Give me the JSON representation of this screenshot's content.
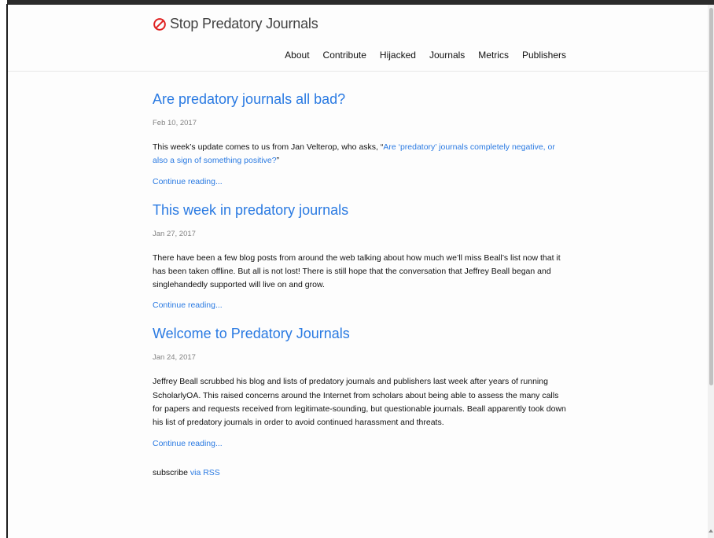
{
  "site": {
    "title": "Stop Predatory Journals"
  },
  "nav": {
    "items": [
      "About",
      "Contribute",
      "Hijacked",
      "Journals",
      "Metrics",
      "Publishers"
    ]
  },
  "posts": [
    {
      "title": "Are predatory journals all bad?",
      "date": "Feb 10, 2017",
      "excerpt_prefix": "This week’s update comes to us from Jan Velterop, who asks, “",
      "excerpt_link": "Are ‘predatory’ journals completely negative, or also a sign of something positive?",
      "excerpt_suffix": "”",
      "read_more": "Continue reading..."
    },
    {
      "title": "This week in predatory journals",
      "date": "Jan 27, 2017",
      "excerpt": "There have been a few blog posts from around the web talking about how much we’ll miss Beall’s list now that it has been taken offline. But all is not lost! There is still hope that the conversation that Jeffrey Beall began and singlehandedly supported will live on and grow.",
      "read_more": "Continue reading..."
    },
    {
      "title": "Welcome to Predatory Journals",
      "date": "Jan 24, 2017",
      "excerpt": "Jeffrey Beall scrubbed his blog and lists of predatory journals and publishers last week after years of running ScholarlyOA. This raised concerns around the Internet from scholars about being able to assess the many calls for papers and requests received from legitimate-sounding, but questionable journals. Beall apparently took down his list of predatory journals in order to avoid continued harassment and threats.",
      "read_more": "Continue reading..."
    }
  ],
  "subscribe": {
    "label": "subscribe",
    "link": "via RSS"
  },
  "colors": {
    "link": "#2a7ae2",
    "text": "#111111",
    "meta": "#828282",
    "stop_icon": "#e02020"
  },
  "icons": {
    "logo": "no-entry-icon"
  }
}
